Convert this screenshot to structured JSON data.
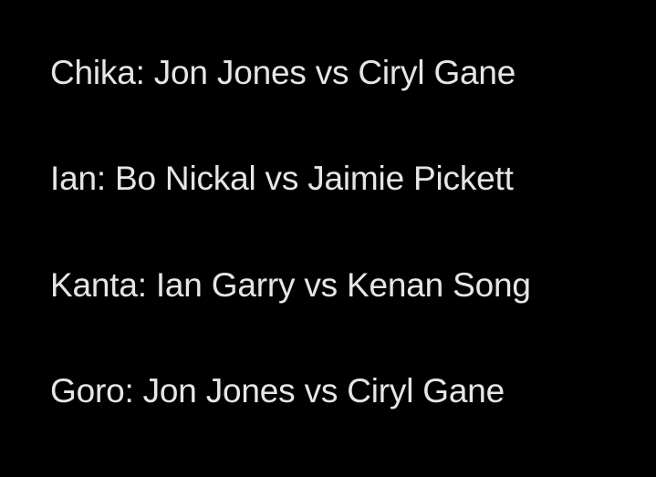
{
  "lines": [
    "Chika: Jon Jones vs Ciryl Gane",
    "Ian: Bo Nickal vs Jaimie Pickett",
    "Kanta: Ian Garry vs Kenan Song",
    "Goro: Jon Jones vs Ciryl Gane"
  ]
}
